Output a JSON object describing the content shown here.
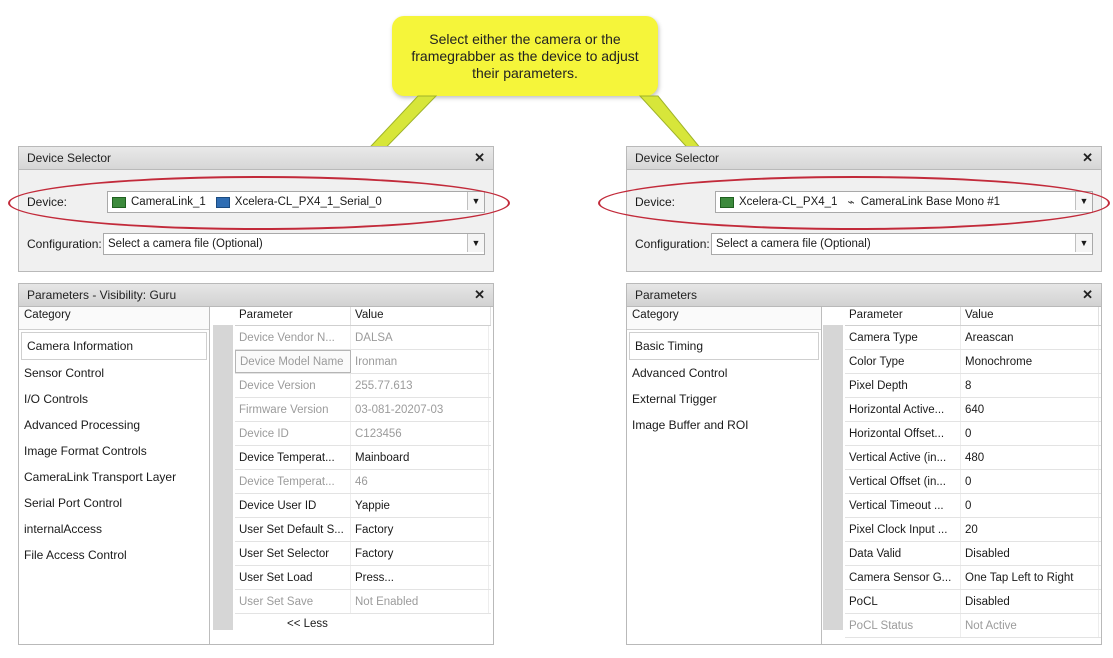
{
  "callout": {
    "text": "Select either the camera or the framegrabber as the device to adjust their parameters."
  },
  "left": {
    "device_selector": {
      "title": "Device Selector",
      "device_label": "Device:",
      "device_value_1": "CameraLink_1",
      "device_value_2": "Xcelera-CL_PX4_1_Serial_0",
      "config_label": "Configuration:",
      "config_value": "Select a camera file (Optional)"
    },
    "parameters": {
      "title": "Parameters - Visibility: Guru",
      "category_header": "Category",
      "categories": [
        "Camera Information",
        "Sensor Control",
        "I/O Controls",
        "Advanced Processing",
        "Image Format Controls",
        "CameraLink Transport Layer",
        "Serial Port Control",
        "internalAccess",
        "File Access Control"
      ],
      "col_param": "Parameter",
      "col_value": "Value",
      "rows": [
        {
          "p": "Device Vendor N...",
          "v": "DALSA",
          "dim": true
        },
        {
          "p": "Device Model Name",
          "v": "Ironman",
          "dim": true
        },
        {
          "p": "Device Version",
          "v": "255.77.613",
          "dim": true
        },
        {
          "p": "Firmware Version",
          "v": "03-081-20207-03",
          "dim": true
        },
        {
          "p": "Device ID",
          "v": "C123456",
          "dim": true
        },
        {
          "p": "Device Temperat...",
          "v": "Mainboard",
          "dim": false
        },
        {
          "p": "Device Temperat...",
          "v": "46",
          "dim": true
        },
        {
          "p": "Device User ID",
          "v": "Yappie",
          "dim": false
        },
        {
          "p": "User Set Default S...",
          "v": "Factory",
          "dim": false
        },
        {
          "p": "User Set Selector",
          "v": "Factory",
          "dim": false
        },
        {
          "p": "User Set Load",
          "v": "Press...",
          "dim": false
        },
        {
          "p": "User Set Save",
          "v": "Not Enabled",
          "dim": true
        }
      ],
      "less": "<< Less"
    }
  },
  "right": {
    "device_selector": {
      "title": "Device Selector",
      "device_label": "Device:",
      "device_value_1": "Xcelera-CL_PX4_1",
      "device_value_2": "CameraLink Base Mono #1",
      "config_label": "Configuration:",
      "config_value": "Select a camera file (Optional)"
    },
    "parameters": {
      "title": "Parameters",
      "category_header": "Category",
      "categories": [
        "Basic Timing",
        "Advanced Control",
        "External Trigger",
        "Image Buffer and ROI"
      ],
      "col_param": "Parameter",
      "col_value": "Value",
      "rows": [
        {
          "p": "Camera Type",
          "v": "Areascan",
          "dim": false
        },
        {
          "p": "Color Type",
          "v": "Monochrome",
          "dim": false
        },
        {
          "p": "Pixel Depth",
          "v": "8",
          "dim": false
        },
        {
          "p": "Horizontal Active...",
          "v": "640",
          "dim": false
        },
        {
          "p": "Horizontal Offset...",
          "v": "0",
          "dim": false
        },
        {
          "p": "Vertical Active (in...",
          "v": "480",
          "dim": false
        },
        {
          "p": "Vertical Offset (in...",
          "v": "0",
          "dim": false
        },
        {
          "p": "Vertical Timeout ...",
          "v": "0",
          "dim": false
        },
        {
          "p": "Pixel Clock Input ...",
          "v": "20",
          "dim": false
        },
        {
          "p": "Data Valid",
          "v": "Disabled",
          "dim": false
        },
        {
          "p": "Camera Sensor G...",
          "v": "One Tap Left to Right",
          "dim": false
        },
        {
          "p": "PoCL",
          "v": "Disabled",
          "dim": false
        },
        {
          "p": "PoCL Status",
          "v": "Not Active",
          "dim": true
        }
      ]
    }
  },
  "colors": {
    "callout": "#f5f53a",
    "oval": "#c22a3a",
    "arrow": "#c8e03a"
  }
}
